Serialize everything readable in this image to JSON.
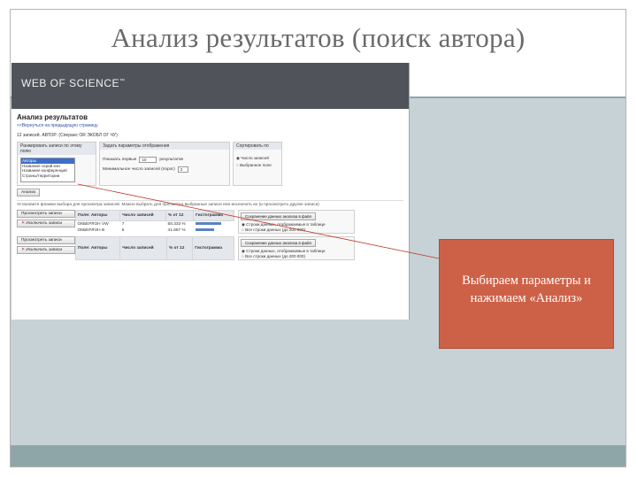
{
  "slide": {
    "title": "Анализ результатов (поиск автора)",
    "callout_text": "Выбираем параметры и нажимаем «Анализ»",
    "colors": {
      "callout": "#cd6147",
      "background": "#c6d2d6",
      "band": "#8fa6a8"
    }
  },
  "wos": {
    "brand": "WEB OF SCIENCE",
    "trademark": "™",
    "page_title": "Анализ результатов",
    "back_link": "<<Вернуться на предыдущую страницу",
    "query": "12 записей. АВТОР: (Сперанс OR ЭКОБЛ ОГ ЧУ)",
    "panel_rank_header": "Ранжировать записи по этому полю",
    "rank_options": [
      "Авторы",
      "Названия серий кни",
      "Названия конференций",
      "Страны/территории"
    ],
    "panel_display_header": "Задать параметры отображения",
    "display_show_label": "Показать первые",
    "display_show_value": "10",
    "display_show_suffix": "результатов",
    "display_min_label": "Минимальное число записей (порог)",
    "display_min_value": "2",
    "panel_sort_header": "Сортировать по",
    "sort_option_count": "Число записей",
    "sort_option_field": "Выбранное поле",
    "analyze_button": "Анализ",
    "hint": "Установите флажки выбора для просмотра записей. Можно выбрать для просмотра выбранные записи или исключить их (и просмотреть другие записи)",
    "side_view_button": "Просмотреть записи",
    "side_exclude_button": "Исключить записи",
    "table_headers": [
      "Поле: Авторы",
      "Число записей",
      "% от 12",
      "Гистограмма"
    ],
    "rows": [
      {
        "author": "ОКБЕРЛОН VW",
        "count": "7",
        "percent": "58.333 %",
        "share": 0.58
      },
      {
        "author": "ОКБЕРЛОН В",
        "count": "5",
        "percent": "41.667 %",
        "share": 0.42
      }
    ],
    "save_button": "Сохранение данных анализа в файл",
    "save_option_displayed": "Строки данных, отображаемые в таблице",
    "save_option_all": "Все строки данных (до 200 000)"
  }
}
